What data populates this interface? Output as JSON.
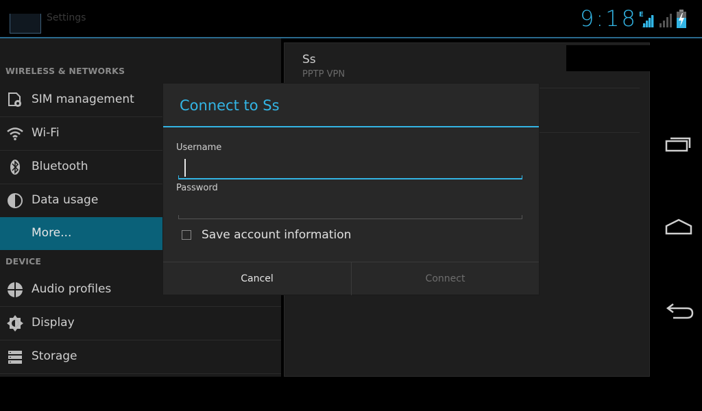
{
  "status_bar": {
    "app_title": "Settings",
    "clock": "9:18",
    "network_type": "E",
    "icons": [
      "settings-app-icon",
      "signal-edge-icon",
      "signal-strength-icon",
      "battery-charging-icon"
    ]
  },
  "sidebar": {
    "categories": [
      "WIRELESS & NETWORKS",
      "DEVICE"
    ],
    "items": [
      {
        "label": "SIM management",
        "icon": "sim-management-icon"
      },
      {
        "label": "Wi-Fi",
        "icon": "wifi-icon"
      },
      {
        "label": "Bluetooth",
        "icon": "bluetooth-icon"
      },
      {
        "label": "Data usage",
        "icon": "data-usage-icon"
      },
      {
        "label": "More...",
        "icon": "",
        "selected": true
      },
      {
        "label": "Audio profiles",
        "icon": "audio-profiles-icon"
      },
      {
        "label": "Display",
        "icon": "display-icon"
      },
      {
        "label": "Storage",
        "icon": "storage-icon"
      }
    ]
  },
  "vpn_list": {
    "items": [
      {
        "name": "Ss",
        "type": "PPTP VPN"
      }
    ]
  },
  "dialog": {
    "title": "Connect to Ss",
    "username_label": "Username",
    "username_value": "",
    "password_label": "Password",
    "password_value": "",
    "save_label": "Save account information",
    "save_checked": false,
    "cancel_label": "Cancel",
    "connect_label": "Connect",
    "connect_enabled": false
  },
  "nav_bar": {
    "buttons": [
      "recent-apps-icon",
      "home-icon",
      "back-icon"
    ]
  },
  "colors": {
    "accent": "#33b5e5",
    "selected_item": "#0a6179",
    "background": "#000000"
  }
}
